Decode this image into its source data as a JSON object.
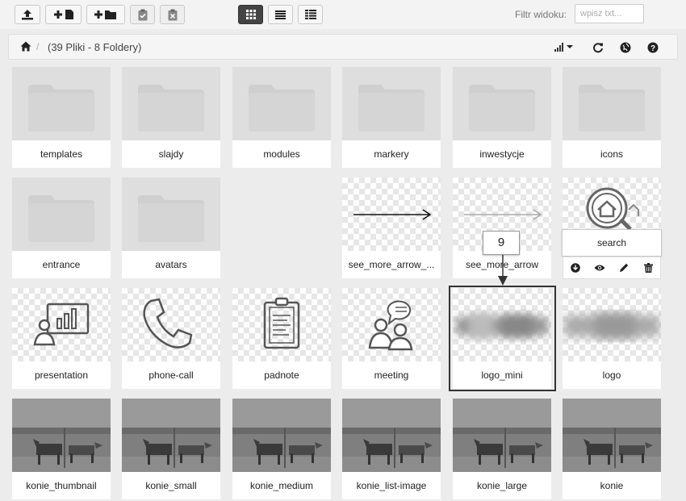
{
  "toolbar": {
    "buttons": [
      {
        "name": "upload-button",
        "icon": "upload-icon"
      },
      {
        "name": "new-file-button",
        "icon": "new-file-icon"
      },
      {
        "name": "new-folder-button",
        "icon": "new-folder-icon"
      },
      {
        "name": "paste-button",
        "icon": "clipboard-check-icon"
      },
      {
        "name": "clear-clipboard-button",
        "icon": "clipboard-x-icon"
      }
    ],
    "views": [
      {
        "name": "grid-view-button",
        "icon": "grid-icon",
        "active": true
      },
      {
        "name": "list-view-button",
        "icon": "list-icon",
        "active": false
      },
      {
        "name": "details-view-button",
        "icon": "table-icon",
        "active": false
      }
    ],
    "filter_label": "Filtr widoku:",
    "filter_placeholder": "wpisz txt..."
  },
  "breadcrumb": {
    "separator": "/",
    "summary": "(39 Pliki - 8 Foldery)"
  },
  "colors": {
    "accent": "#444444",
    "folder": "#cfcfcf",
    "background": "#ececec"
  },
  "items": [
    {
      "label": "templates",
      "type": "folder"
    },
    {
      "label": "slajdy",
      "type": "folder"
    },
    {
      "label": "modules",
      "type": "folder"
    },
    {
      "label": "markery",
      "type": "folder"
    },
    {
      "label": "inwestycje",
      "type": "folder"
    },
    {
      "label": "icons",
      "type": "folder"
    },
    {
      "label": "entrance",
      "type": "folder"
    },
    {
      "label": "avatars",
      "type": "folder"
    },
    {
      "label": "see_more_arrow_...",
      "type": "image",
      "icon": "arrow-right-icon"
    },
    {
      "label": "see_more_arrow",
      "type": "image",
      "icon": "arrow-right-light-icon"
    },
    {
      "label": "search",
      "type": "image",
      "icon": "home-search-icon"
    },
    {
      "label": "presentation",
      "type": "image",
      "icon": "presentation-icon"
    },
    {
      "label": "phone-call",
      "type": "image",
      "icon": "phone-icon"
    },
    {
      "label": "padnote",
      "type": "image",
      "icon": "clipboard-notes-icon"
    },
    {
      "label": "meeting",
      "type": "image",
      "icon": "meeting-icon"
    },
    {
      "label": "logo_mini",
      "type": "image",
      "icon": "blurred-logo-icon"
    },
    {
      "label": "logo",
      "type": "image",
      "icon": "blurred-logo-icon"
    },
    {
      "label": "konie_thumbnail",
      "type": "photo"
    },
    {
      "label": "konie_small",
      "type": "photo"
    },
    {
      "label": "konie_medium",
      "type": "photo"
    },
    {
      "label": "konie_list-image",
      "type": "photo"
    },
    {
      "label": "konie_large",
      "type": "photo"
    },
    {
      "label": "konie",
      "type": "photo"
    }
  ],
  "hover_actions": [
    {
      "name": "download-button",
      "icon": "download-icon"
    },
    {
      "name": "preview-button",
      "icon": "eye-icon"
    },
    {
      "name": "rename-button",
      "icon": "pencil-icon"
    },
    {
      "name": "delete-button",
      "icon": "trash-icon"
    }
  ],
  "step_badge": "9"
}
